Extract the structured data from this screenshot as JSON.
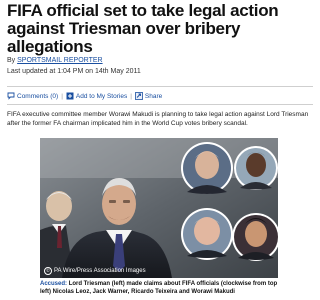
{
  "article": {
    "headline": "FIFA official set to take legal action against Triesman over bribery allegations",
    "byline_prefix": "By",
    "byline_author": "SPORTSMAIL REPORTER",
    "last_updated": "Last updated at 1:04 PM on 14th May 2011",
    "summary": "FIFA executive committee member Worawi Makudi is planning to take legal action against Lord Triesman after the former FA chairman implicated him in the World Cup votes bribery scandal."
  },
  "share_bar": {
    "comments_label": "Comments (0)",
    "add_stories_label": "Add to My Stories",
    "share_label": "Share",
    "icons": [
      "comment-icon",
      "add-story-icon",
      "share-icon"
    ]
  },
  "photo": {
    "credit": "PA Wire/Press Association Images",
    "credit_icon": "copyright-icon"
  },
  "caption": {
    "lead": "Accused:",
    "text": "Lord Triesman (left) made claims about FIFA officials (clockwise from top left) Nicolas Leoz, Jack Warner, Ricardo Teixeira and Worawi Makudi"
  },
  "colors": {
    "link": "#1a4fa0",
    "headline": "#111111",
    "caption_lead": "#1a4fa0"
  }
}
